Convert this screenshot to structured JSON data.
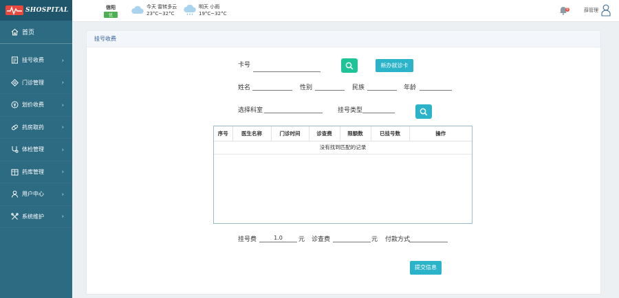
{
  "logo": {
    "text": "SHOSPITAL"
  },
  "sidebar": {
    "home": {
      "label": "首页",
      "icon": "home-icon"
    },
    "items": [
      {
        "label": "挂号收费",
        "icon": "register-icon"
      },
      {
        "label": "门诊管理",
        "icon": "outpatient-icon"
      },
      {
        "label": "划价收费",
        "icon": "pricing-icon"
      },
      {
        "label": "药房取药",
        "icon": "pharmacy-icon"
      },
      {
        "label": "体检管理",
        "icon": "checkup-icon"
      },
      {
        "label": "药库管理",
        "icon": "warehouse-icon"
      },
      {
        "label": "用户中心",
        "icon": "user-icon"
      },
      {
        "label": "系统维护",
        "icon": "tools-icon"
      }
    ]
  },
  "header": {
    "city": "信阳",
    "aqi": "优",
    "today": {
      "line1": "今天  雷转多云",
      "line2": "23°C~32°C"
    },
    "tomorrow": {
      "line1": "明天  小雨",
      "line2": "19°C~32°C"
    },
    "notification_count": "0",
    "admin": "薛管理"
  },
  "panel": {
    "title": "挂号收费",
    "card_label": "卡号",
    "new_card_button": "新办就诊卡",
    "name_label": "姓名",
    "gender_label": "性别",
    "ethnicity_label": "民族",
    "age_label": "年龄",
    "dept_label": "选择科室",
    "reg_type_label": "挂号类型",
    "table": {
      "headers": [
        "序号",
        "医生名称",
        "门诊时间",
        "诊查费",
        "限额数",
        "已挂号数",
        "操作"
      ],
      "empty_text": "没有找到匹配的记录"
    },
    "reg_fee_label": "挂号费",
    "reg_fee_value": "1.0",
    "yuan1": "元",
    "exam_fee_label": "诊查费",
    "yuan2": "元",
    "pay_label": "付款方式",
    "submit_button": "提交信息"
  },
  "colors": {
    "sidebar": "#2c6b82",
    "accent_green": "#1cc497",
    "accent_teal": "#2bb3c9"
  }
}
